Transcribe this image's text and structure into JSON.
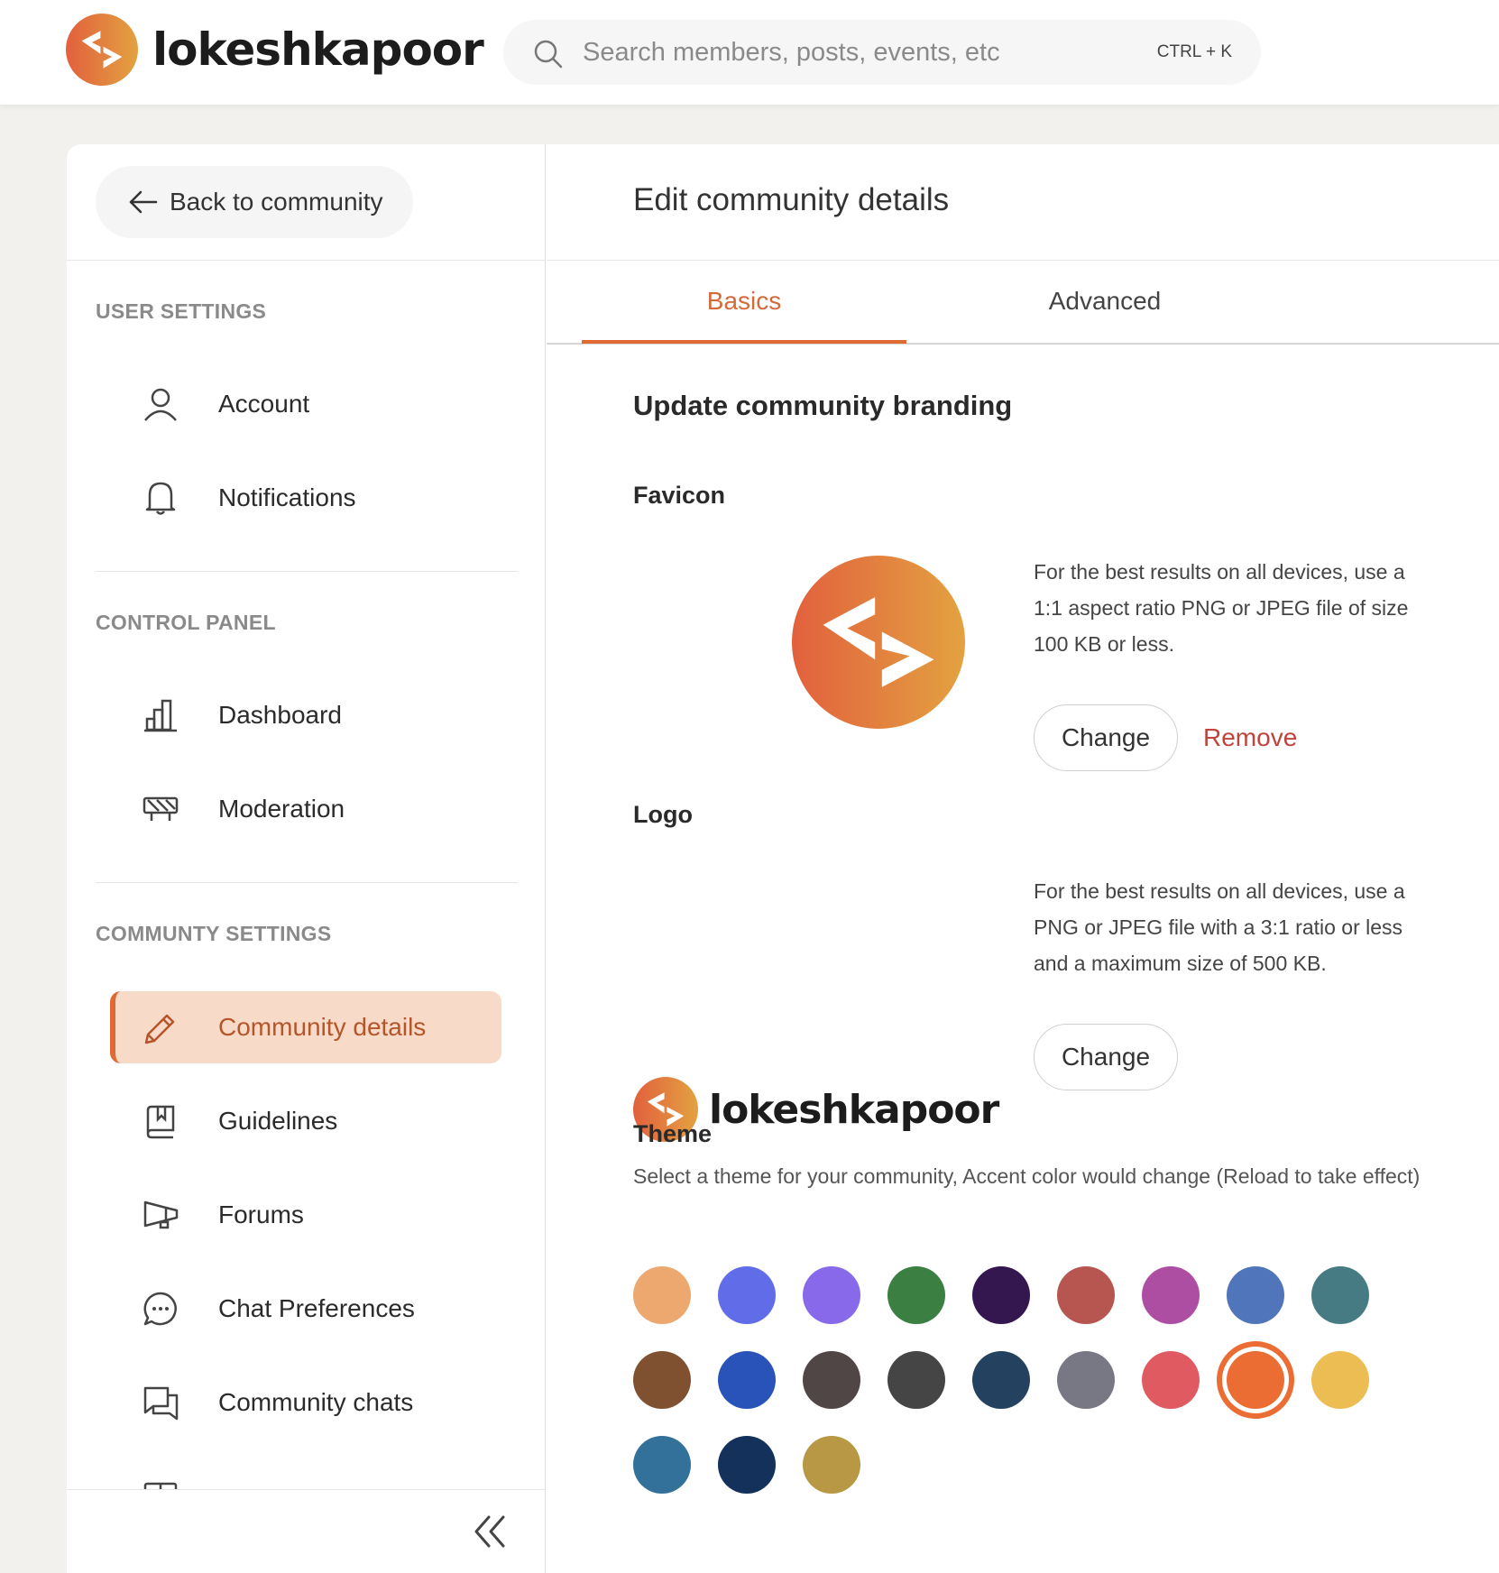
{
  "header": {
    "brand_name": "lokeshkapoor",
    "search_placeholder": "Search members, posts, events, etc",
    "search_shortcut": "CTRL + K"
  },
  "sidebar": {
    "back_label": "Back to community",
    "sections": [
      {
        "title": "USER SETTINGS",
        "items": [
          {
            "label": "Account",
            "icon": "user-icon"
          },
          {
            "label": "Notifications",
            "icon": "bell-icon"
          }
        ]
      },
      {
        "title": "CONTROL PANEL",
        "items": [
          {
            "label": "Dashboard",
            "icon": "bar-chart-icon"
          },
          {
            "label": "Moderation",
            "icon": "barrier-icon"
          }
        ]
      },
      {
        "title": "COMMUNTY SETTINGS",
        "items": [
          {
            "label": "Community details",
            "icon": "pencil-icon",
            "active": true
          },
          {
            "label": "Guidelines",
            "icon": "book-icon"
          },
          {
            "label": "Forums",
            "icon": "megaphone-icon"
          },
          {
            "label": "Chat Preferences",
            "icon": "chat-bubble-icon"
          },
          {
            "label": "Community chats",
            "icon": "chats-icon"
          }
        ]
      }
    ],
    "collapse_icon": "double-chevron-left-icon"
  },
  "main": {
    "title": "Edit community details",
    "tabs": [
      {
        "label": "Basics",
        "active": true
      },
      {
        "label": "Advanced",
        "active": false
      }
    ],
    "branding_heading": "Update community branding",
    "favicon": {
      "heading": "Favicon",
      "help": "For the best results on all devices, use a 1:1 aspect ratio PNG or JPEG file of size 100 KB or less.",
      "change_label": "Change",
      "remove_label": "Remove"
    },
    "logo": {
      "heading": "Logo",
      "brand_name": "lokeshkapoor",
      "help": "For the best results on all devices, use a PNG or JPEG file with a 3:1 ratio or less and a maximum size of 500 KB.",
      "change_label": "Change"
    },
    "theme": {
      "heading": "Theme",
      "description": "Select a theme for your community, Accent color would change (Reload to take effect)",
      "selected_index": 16,
      "colors": [
        "#eca86f",
        "#616ce8",
        "#8869ea",
        "#3b7f43",
        "#34174f",
        "#b75550",
        "#ad4ea2",
        "#5075bb",
        "#477b83",
        "#7f5131",
        "#2a53b9",
        "#504645",
        "#454545",
        "#24425f",
        "#777884",
        "#e05a62",
        "#eb6d33",
        "#ebbd53",
        "#33719b",
        "#13315a",
        "#b89745"
      ]
    }
  },
  "colors": {
    "accent": "#e06a34",
    "active_bg": "#f8dac8",
    "remove": "#c0443b"
  }
}
